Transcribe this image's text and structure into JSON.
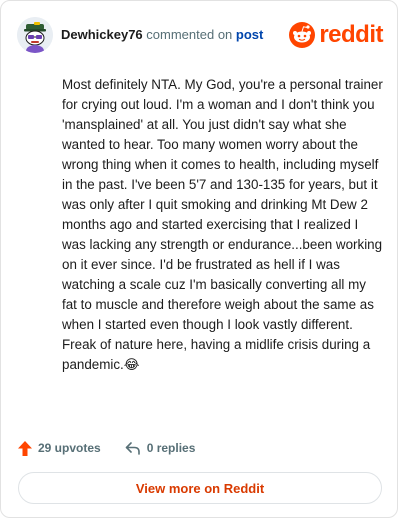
{
  "header": {
    "username": "Dewhickey76",
    "action_text": "commented on",
    "post_link": "post",
    "brand_text": "reddit"
  },
  "comment": {
    "text": "Most definitely NTA. My God, you're a personal trainer for crying out loud. I'm a woman and I don't think you 'mansplained' at all. You just didn't say what she wanted to hear. Too many women worry about the wrong thing when it comes to health, including myself in the past. I've been 5'7 and 130-135 for years, but it was only after I quit smoking and drinking Mt Dew 2 months ago and started exercising that I realized I was lacking any strength or endurance...been working on it ever since. I'd be frustrated as hell if I was watching a scale cuz I'm basically converting all my fat to muscle and therefore weigh about the same as when I started even though I look vastly different. Freak of nature here, having a midlife crisis during a pandemic.😂"
  },
  "stats": {
    "upvotes": "29 upvotes",
    "replies": "0 replies"
  },
  "footer": {
    "view_more": "View more on Reddit"
  },
  "icons": {
    "avatar": "snoo-avatar-icon",
    "brand": "reddit-logo-icon",
    "upvote": "upvote-arrow-icon",
    "reply": "reply-arrow-icon"
  },
  "colors": {
    "brand": "#ff4500",
    "link": "#0045ac",
    "cta": "#d93a00",
    "muted": "#576f76"
  }
}
